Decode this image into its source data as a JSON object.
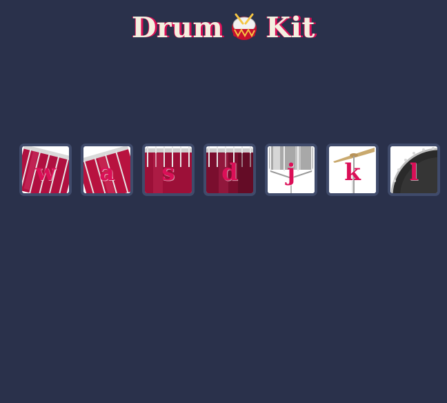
{
  "header": {
    "title_left": "Drum",
    "title_right": "Kit",
    "emoji_icon": "drum-emoji-icon"
  },
  "colors": {
    "background": "#2a314b",
    "accent": "#db0f57",
    "tile_border": "#404b6b",
    "title_text": "#f3f0e0"
  },
  "drums": [
    {
      "key": "w",
      "icon": "tom-1-icon"
    },
    {
      "key": "a",
      "icon": "tom-2-icon"
    },
    {
      "key": "s",
      "icon": "tom-3-icon"
    },
    {
      "key": "d",
      "icon": "tom-4-icon"
    },
    {
      "key": "j",
      "icon": "snare-icon"
    },
    {
      "key": "k",
      "icon": "crash-cymbal-icon"
    },
    {
      "key": "l",
      "icon": "kick-drum-icon"
    }
  ]
}
